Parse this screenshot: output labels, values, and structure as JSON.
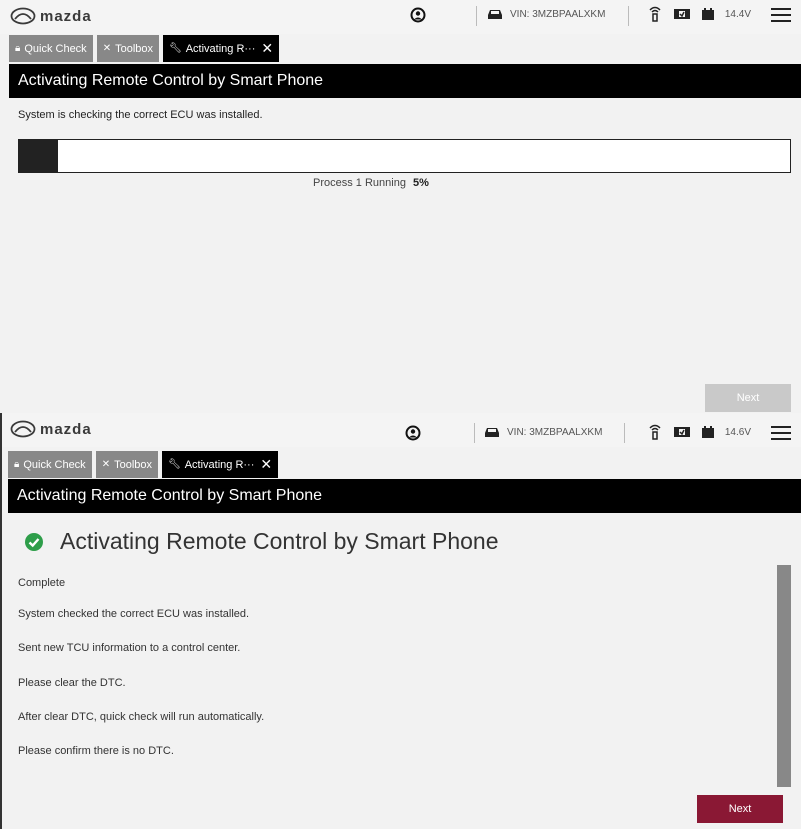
{
  "screen1": {
    "header": {
      "logo_text": "mazda",
      "vin": "VIN: 3MZBPAALXKM",
      "voltage": "14.4V"
    },
    "tabs": [
      {
        "label": "Quick Check"
      },
      {
        "label": "Toolbox"
      },
      {
        "label": "Activating R···"
      }
    ],
    "title": "Activating Remote Control by Smart Phone",
    "message": "System is checking the correct ECU was installed.",
    "progress": {
      "label": "Process 1 Running",
      "percent_text": "5%",
      "value": 0.05
    },
    "next_label": "Next"
  },
  "screen2": {
    "header": {
      "logo_text": "mazda",
      "vin": "VIN: 3MZBPAALXKM",
      "voltage": "14.6V"
    },
    "tabs": [
      {
        "label": "Quick Check"
      },
      {
        "label": "Toolbox"
      },
      {
        "label": "Activating R···"
      }
    ],
    "title": "Activating Remote Control by Smart Phone",
    "complete_heading": "Activating Remote Control by Smart Phone",
    "lines": [
      "Complete",
      "System checked the correct ECU was installed.",
      "Sent new TCU information to a control center.",
      "Please clear the DTC.",
      "After clear DTC, quick check will run automatically.",
      "Please confirm there is no DTC."
    ],
    "next_label": "Next"
  },
  "colors": {
    "accent": "#8a1834",
    "success": "#2e9e4a",
    "disabled": "#c9c9c9"
  }
}
